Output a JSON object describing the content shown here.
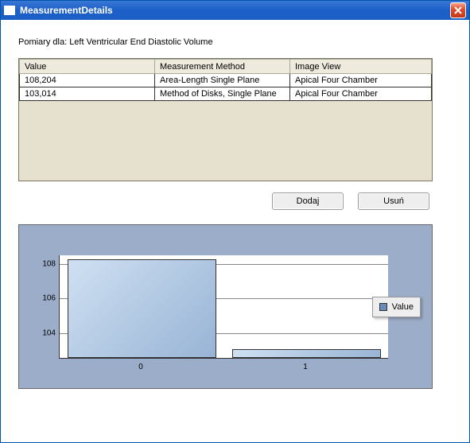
{
  "window": {
    "title": "MeasurementDetails"
  },
  "prompt": "Pomiary dla: Left Ventricular End Diastolic Volume",
  "table": {
    "headers": {
      "value": "Value",
      "method": "Measurement Method",
      "view": "Image View"
    },
    "rows": [
      {
        "value": "108,204",
        "method": "Area-Length Single Plane",
        "view": "Apical Four Chamber"
      },
      {
        "value": "103,014",
        "method": "Method of Disks, Single Plane",
        "view": "Apical Four Chamber"
      }
    ]
  },
  "buttons": {
    "add": "Dodaj",
    "remove": "Usuń"
  },
  "legend": {
    "label": "Value"
  },
  "yticks": {
    "t0": "104",
    "t1": "106",
    "t2": "108"
  },
  "xticks": {
    "x0": "0",
    "x1": "1"
  },
  "chart_data": {
    "type": "bar",
    "categories": [
      "0",
      "1"
    ],
    "series": [
      {
        "name": "Value",
        "values": [
          108.204,
          103.014
        ]
      }
    ],
    "title": "",
    "xlabel": "",
    "ylabel": "",
    "ylim": [
      102.5,
      108.5
    ]
  }
}
